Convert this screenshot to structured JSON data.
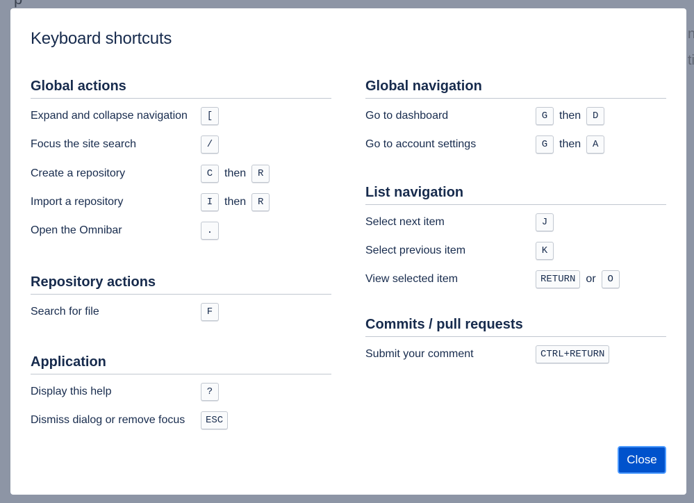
{
  "background": {
    "fragment_top": "p",
    "fragment_a": "nt",
    "fragment_b": "tiv"
  },
  "dialog": {
    "title": "Keyboard shortcuts",
    "close_label": "Close"
  },
  "left_sections": [
    {
      "heading": "Global actions",
      "rows": [
        {
          "label": "Expand and collapse navigation",
          "keys": [
            "["
          ],
          "sep": ""
        },
        {
          "label": "Focus the site search",
          "keys": [
            "/"
          ],
          "sep": ""
        },
        {
          "label": "Create a repository",
          "keys": [
            "C",
            "R"
          ],
          "sep": "then"
        },
        {
          "label": "Import a repository",
          "keys": [
            "I",
            "R"
          ],
          "sep": "then"
        },
        {
          "label": "Open the Omnibar",
          "keys": [
            "."
          ],
          "sep": ""
        }
      ]
    },
    {
      "heading": "Repository actions",
      "rows": [
        {
          "label": "Search for file",
          "keys": [
            "F"
          ],
          "sep": ""
        }
      ]
    },
    {
      "heading": "Application",
      "rows": [
        {
          "label": "Display this help",
          "keys": [
            "?"
          ],
          "sep": ""
        },
        {
          "label": "Dismiss dialog or remove focus",
          "keys": [
            "ESC"
          ],
          "sep": ""
        }
      ]
    }
  ],
  "right_sections": [
    {
      "heading": "Global navigation",
      "rows": [
        {
          "label": "Go to dashboard",
          "keys": [
            "G",
            "D"
          ],
          "sep": "then"
        },
        {
          "label": "Go to account settings",
          "keys": [
            "G",
            "A"
          ],
          "sep": "then"
        }
      ]
    },
    {
      "heading": "List navigation",
      "rows": [
        {
          "label": "Select next item",
          "keys": [
            "J"
          ],
          "sep": ""
        },
        {
          "label": "Select previous item",
          "keys": [
            "K"
          ],
          "sep": ""
        },
        {
          "label": "View selected item",
          "keys": [
            "RETURN",
            "O"
          ],
          "sep": "or"
        }
      ]
    },
    {
      "heading": "Commits / pull requests",
      "rows": [
        {
          "label": "Submit your comment",
          "keys": [
            "CTRL+RETURN"
          ],
          "sep": ""
        }
      ]
    }
  ]
}
